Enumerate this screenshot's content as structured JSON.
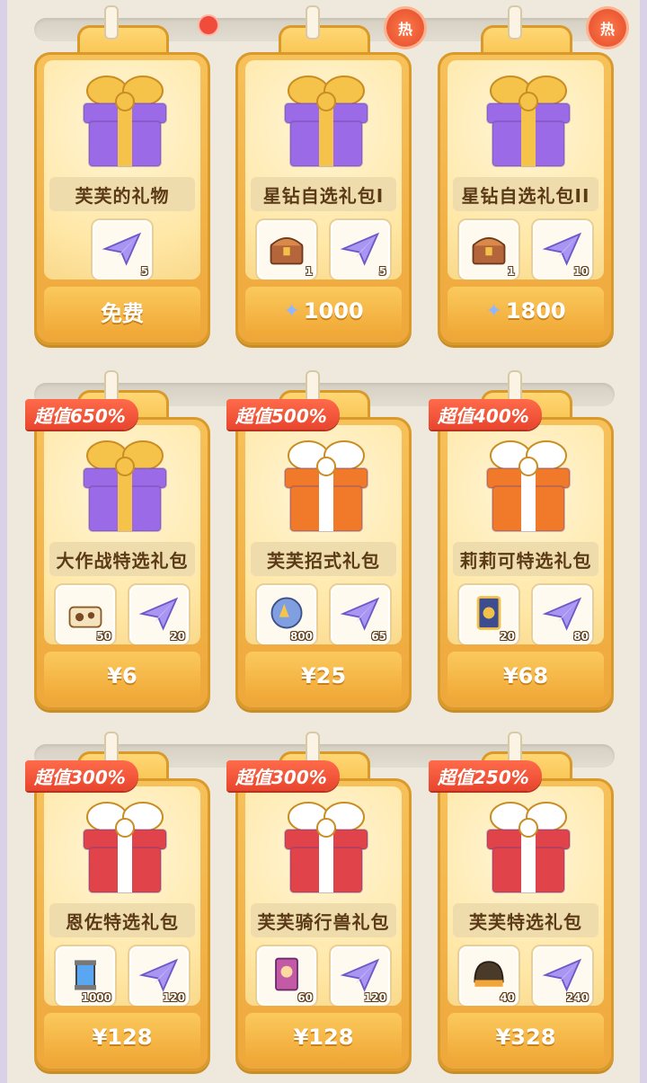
{
  "packs": [
    {
      "name": "芙芙的礼物",
      "price": "免费",
      "price_icon": "",
      "badge": "",
      "hot": "",
      "dot": true,
      "gift": "purple",
      "items": [
        {
          "icon": "paper-plane",
          "qty": "5"
        }
      ]
    },
    {
      "name": "星钻自选礼包I",
      "price": "1000",
      "price_icon": "star-diamond",
      "badge": "",
      "hot": "热",
      "dot": false,
      "gift": "purple",
      "items": [
        {
          "icon": "treasure-chest",
          "qty": "1"
        },
        {
          "icon": "paper-plane",
          "qty": "5"
        }
      ]
    },
    {
      "name": "星钻自选礼包II",
      "price": "1800",
      "price_icon": "star-diamond",
      "badge": "",
      "hot": "热",
      "dot": false,
      "gift": "purple",
      "items": [
        {
          "icon": "treasure-chest",
          "qty": "1"
        },
        {
          "icon": "paper-plane",
          "qty": "10"
        }
      ]
    },
    {
      "name": "大作战特选礼包",
      "price": "¥6",
      "price_icon": "",
      "badge": "超值650%",
      "hot": "",
      "dot": false,
      "gift": "purple",
      "items": [
        {
          "icon": "cake-box",
          "qty": "50"
        },
        {
          "icon": "paper-plane",
          "qty": "20"
        }
      ]
    },
    {
      "name": "芙芙招式礼包",
      "price": "¥25",
      "price_icon": "",
      "badge": "超值500%",
      "hot": "",
      "dot": false,
      "gift": "orange",
      "items": [
        {
          "icon": "crystal-orb",
          "qty": "800"
        },
        {
          "icon": "paper-plane",
          "qty": "65"
        }
      ]
    },
    {
      "name": "莉莉可特选礼包",
      "price": "¥68",
      "price_icon": "",
      "badge": "超值400%",
      "hot": "",
      "dot": false,
      "gift": "orange",
      "items": [
        {
          "icon": "card",
          "qty": "20"
        },
        {
          "icon": "paper-plane",
          "qty": "80"
        }
      ]
    },
    {
      "name": "恩佐特选礼包",
      "price": "¥128",
      "price_icon": "",
      "badge": "超值300%",
      "hot": "",
      "dot": false,
      "gift": "red",
      "items": [
        {
          "icon": "canister",
          "qty": "1000"
        },
        {
          "icon": "paper-plane",
          "qty": "120"
        }
      ]
    },
    {
      "name": "芙芙骑行兽礼包",
      "price": "¥128",
      "price_icon": "",
      "badge": "超值300%",
      "hot": "",
      "dot": false,
      "gift": "red",
      "items": [
        {
          "icon": "character-card",
          "qty": "60"
        },
        {
          "icon": "paper-plane",
          "qty": "120"
        }
      ]
    },
    {
      "name": "芙芙特选礼包",
      "price": "¥328",
      "price_icon": "",
      "badge": "超值250%",
      "hot": "",
      "dot": false,
      "gift": "red",
      "items": [
        {
          "icon": "helmet",
          "qty": "40"
        },
        {
          "icon": "paper-plane",
          "qty": "240"
        }
      ]
    }
  ],
  "colors": {
    "purple": "#9b6ae6",
    "orange": "#f07a2a",
    "red": "#e0444a",
    "ribbon_gold": "#f5c24a",
    "ribbon_white": "#ffffff"
  }
}
